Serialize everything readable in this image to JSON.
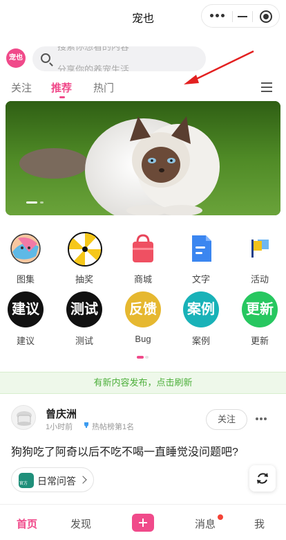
{
  "header": {
    "title": "宠也",
    "capsule_icons": [
      "more-icon",
      "minimize-icon",
      "target-icon"
    ]
  },
  "search": {
    "logo_text": "宠也",
    "placeholder_top": "搜索你想看的内容",
    "placeholder_bottom": "分享你的养宠生活"
  },
  "tabs": [
    {
      "label": "关注",
      "active": false
    },
    {
      "label": "推荐",
      "active": true
    },
    {
      "label": "热门",
      "active": false
    }
  ],
  "colors": {
    "accent": "#f04a8a",
    "notice_green": "#4caf3a"
  },
  "banner": {
    "icon": "cat-photo",
    "slide_current": 1,
    "slide_total": 2
  },
  "grid_row1": [
    {
      "label": "图集",
      "icon": "album-icon"
    },
    {
      "label": "抽奖",
      "icon": "lottery-wheel-icon"
    },
    {
      "label": "商城",
      "icon": "shopping-bag-icon"
    },
    {
      "label": "文字",
      "icon": "document-icon"
    },
    {
      "label": "活动",
      "icon": "flag-icon"
    }
  ],
  "grid_row2": [
    {
      "label": "建议",
      "icon_text": "建议",
      "color": "#111111"
    },
    {
      "label": "测试",
      "icon_text": "测试",
      "color": "#111111"
    },
    {
      "label": "Bug",
      "icon_text": "反馈",
      "color": "#e6b830"
    },
    {
      "label": "案例",
      "icon_text": "案例",
      "color": "#19b2b8"
    },
    {
      "label": "更新",
      "icon_text": "更新",
      "color": "#27c760"
    }
  ],
  "notice": {
    "text": "有新内容发布，点击刷新"
  },
  "post": {
    "author": "曾庆洲",
    "time": "1小时前",
    "rank": "热帖榜第1名",
    "follow_label": "关注",
    "text": "狗狗吃了阿奇以后不吃不喝一直睡觉没问题吧?",
    "topic_label": "日常问答",
    "topic_icon_text": "官方"
  },
  "tabbar": [
    {
      "label": "首页",
      "active": true
    },
    {
      "label": "发现",
      "active": false
    },
    {
      "label": "消息",
      "active": false,
      "dot": true
    },
    {
      "label": "我",
      "active": false
    }
  ]
}
